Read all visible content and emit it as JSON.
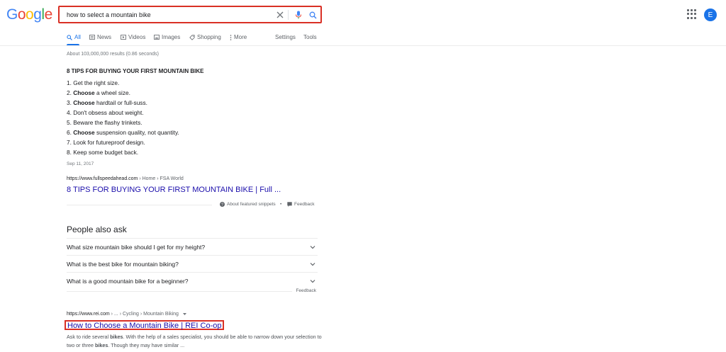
{
  "logo": {
    "letters": [
      "G",
      "o",
      "o",
      "g",
      "l",
      "e"
    ],
    "colors": [
      "#4285f4",
      "#ea4335",
      "#fbbc05",
      "#4285f4",
      "#34a853",
      "#ea4335"
    ]
  },
  "search": {
    "query": "how to select a mountain bike",
    "icons": [
      "close-icon",
      "mic-icon",
      "search-icon"
    ]
  },
  "header": {
    "avatar_letter": "E",
    "accent": "#1a73e8",
    "highlight": "#d93025"
  },
  "tabs": {
    "all": "All",
    "news": "News",
    "videos": "Videos",
    "images": "Images",
    "shopping": "Shopping",
    "more": "More",
    "settings": "Settings",
    "tools": "Tools"
  },
  "stats": "About 103,000,000 results (0.86 seconds)",
  "featured_snippet": {
    "title": "8 TIPS FOR BUYING YOUR FIRST MOUNTAIN BIKE",
    "tips": [
      {
        "num": "1.",
        "bold": "",
        "rest": "Get the right size."
      },
      {
        "num": "2.",
        "bold": "Choose",
        "rest": " a wheel size."
      },
      {
        "num": "3.",
        "bold": "Choose",
        "rest": " hardtail or full-suss."
      },
      {
        "num": "4.",
        "bold": "",
        "rest": "Don't obsess about weight."
      },
      {
        "num": "5.",
        "bold": "",
        "rest": "Beware the flashy trinkets."
      },
      {
        "num": "6.",
        "bold": "Choose",
        "rest": " suspension quality, not quantity."
      },
      {
        "num": "7.",
        "bold": "",
        "rest": "Look for futureproof design."
      },
      {
        "num": "8.",
        "bold": "",
        "rest": "Keep some budget back."
      }
    ],
    "date": "Sep 11, 2017",
    "url": "https://www.fullspeedahead.com",
    "breadcrumb": " › Home › FSA World",
    "link_title": "8 TIPS FOR BUYING YOUR FIRST MOUNTAIN BIKE | Full ...",
    "about": "About featured snippets",
    "dot": "•",
    "feedback": "Feedback"
  },
  "people_also_ask": {
    "title": "People also ask",
    "questions": [
      "What size mountain bike should I get for my height?",
      "What is the best bike for mountain biking?",
      "What is a good mountain bike for a beginner?"
    ],
    "feedback": "Feedback"
  },
  "result": {
    "url": "https://www.rei.com",
    "breadcrumb": " › ... › Cycling › Mountain Biking",
    "title": "How to Choose a Mountain Bike | REI Co-op",
    "desc": {
      "p1": "Ask to ride several ",
      "b1": "bikes",
      "p2": ". With the help of a sales specialist, you should be able to narrow down your selection to two or three ",
      "b2": "bikes",
      "p3": ". Though they may have similar ..."
    }
  }
}
